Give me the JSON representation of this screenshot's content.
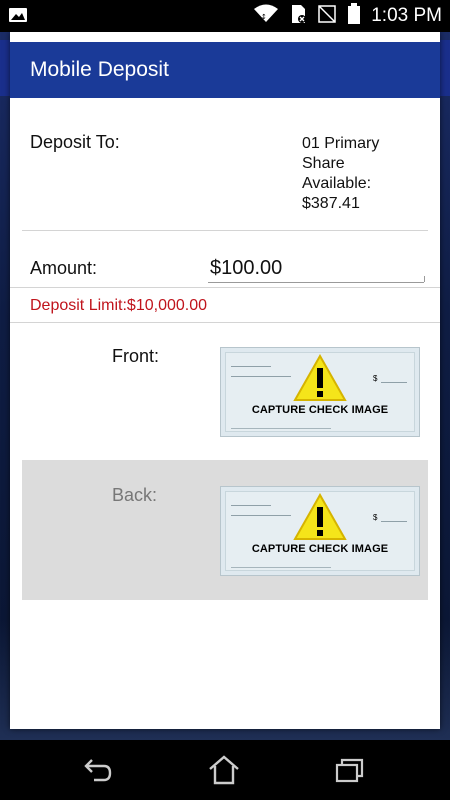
{
  "status_bar": {
    "time": "1:03 PM",
    "icons": [
      "image-icon",
      "wifi-icon",
      "sim-no-signal-icon",
      "no-sim-icon",
      "battery-icon"
    ]
  },
  "dialog": {
    "title": "Mobile Deposit",
    "deposit_to_label": "Deposit To:",
    "account_lines": [
      "01 Primary",
      "Share",
      "Available:",
      "$387.41"
    ],
    "amount_label": "Amount:",
    "amount_value": "$100.00",
    "deposit_limit": "Deposit Limit:$10,000.00",
    "front_label": "Front:",
    "back_label": "Back:",
    "capture_caption": "CAPTURE CHECK IMAGE",
    "check_dollar": "$"
  },
  "navigation": {
    "icons": [
      "back-icon",
      "home-icon",
      "recent-apps-icon"
    ]
  },
  "colors": {
    "header_blue": "#1a3a98",
    "limit_red": "#c0141c",
    "back_panel_gray": "#dcdcdc"
  }
}
